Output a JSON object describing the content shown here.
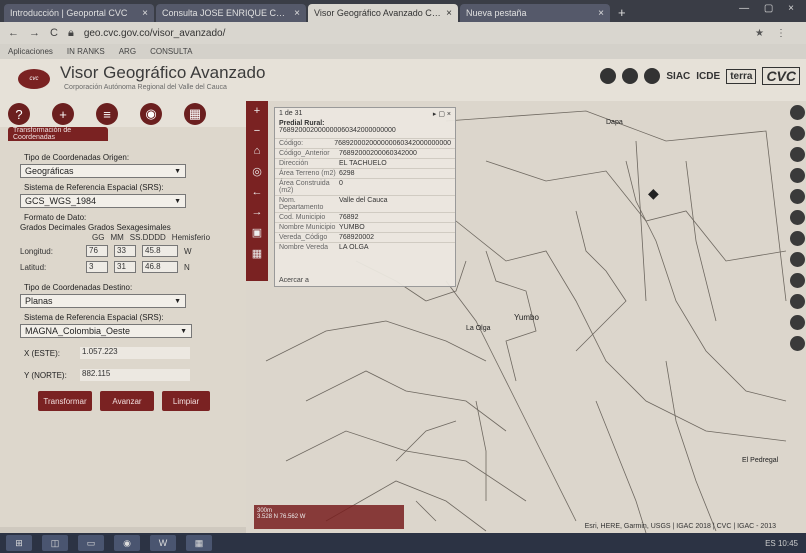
{
  "browser": {
    "tabs": [
      {
        "label": "Introducción | Geoportal CVC",
        "active": false
      },
      {
        "label": "Consulta JOSE ENRIQUE CARVAJAL",
        "active": false
      },
      {
        "label": "Visor Geográfico Avanzado CVC",
        "active": true
      },
      {
        "label": "Nueva pestaña",
        "active": false
      }
    ],
    "new_tab": "+",
    "url": "geo.cvc.gov.co/visor_avanzado/",
    "bookmarks": [
      "Aplicaciones",
      "IN RANKS",
      "ARG",
      "CONSULTA"
    ]
  },
  "app": {
    "title": "Visor Geográfico Avanzado",
    "subtitle": "Corporación Autónoma Regional del Valle del Cauca",
    "logo_text": "cvc",
    "partners": [
      "SIAC",
      "ICDE",
      "terra",
      "CVC"
    ]
  },
  "tools": [
    {
      "icon": "help-icon",
      "glyph": "?"
    },
    {
      "icon": "add-icon",
      "glyph": "+"
    },
    {
      "icon": "layers-icon",
      "glyph": "≡"
    },
    {
      "icon": "location-icon",
      "glyph": "◉"
    },
    {
      "icon": "print-icon",
      "glyph": "▦"
    }
  ],
  "panel": {
    "tab_label": "Transformación de Coordenadas",
    "coord_type_label": "Tipo de Coordenadas Origen:",
    "coord_type_value": "Geográficas",
    "srs_label": "Sistema de Referencia Espacial (SRS):",
    "srs_value": "GCS_WGS_1984",
    "format_label": "Formato de Dato:",
    "format_options": "Grados Decimales  Grados Sexagesimales",
    "header_cols": [
      "GG",
      "MM",
      "SS.DDDD",
      "Hemisferio"
    ],
    "longitude_label": "Longitud:",
    "longitude_values": [
      "76",
      "33",
      "45.8",
      "W"
    ],
    "latitude_label": "Latitud:",
    "latitude_values": [
      "3",
      "31",
      "46.8",
      "N"
    ],
    "dest_type_label": "Tipo de Coordenadas Destino:",
    "dest_type_value": "Planas",
    "dest_srs_label": "Sistema de Referencia Espacial (SRS):",
    "dest_srs_value": "MAGNA_Colombia_Oeste",
    "x_label": "X (ESTE):",
    "x_value": "1.057.223",
    "y_label": "Y (NORTE):",
    "y_value": "882.115",
    "buttons": [
      "Transformar",
      "Avanzar",
      "Limpiar"
    ]
  },
  "popup": {
    "header": "1 de 31",
    "title": "Predial Rural:",
    "title_value": "768920002000000060342000000000",
    "rows": [
      {
        "k": "Código:",
        "v": "768920002000000060342000000000"
      },
      {
        "k": "Código_Anterior",
        "v": "76892000200060342000"
      },
      {
        "k": "Dirección",
        "v": "EL TACHUELO"
      },
      {
        "k": "Área Terreno (m2)",
        "v": "6298"
      },
      {
        "k": "Área Construida (m2)",
        "v": "0"
      },
      {
        "k": "Nom. Departamento",
        "v": "Valle del Cauca"
      },
      {
        "k": "Cod. Municipio",
        "v": "76892"
      },
      {
        "k": "Nombre Municipio",
        "v": "YUMBO"
      },
      {
        "k": "Vereda_Código",
        "v": "768920002"
      },
      {
        "k": "Nombre Vereda",
        "v": "LA OLGA"
      }
    ],
    "footer": "Acercar a"
  },
  "map": {
    "labels": [
      {
        "text": "Yumbo",
        "name": "map-label-yumbo"
      },
      {
        "text": "La Olga",
        "name": "map-label-la-olga"
      },
      {
        "text": "El Pedregal",
        "name": "map-label-el-pedregal"
      },
      {
        "text": "Dapa",
        "name": "map-label-dapa"
      }
    ],
    "attribution": "Esri, HERE, Garmin, USGS | IGAC 2018 | CVC | IGAC - 2013",
    "scale_label": "300m",
    "scale_coords": "3.528 N  76.562 W"
  },
  "taskbar": [
    "⊞",
    "◫",
    "▭",
    "◉",
    "W",
    "▦"
  ],
  "tray": "ES  10:45"
}
